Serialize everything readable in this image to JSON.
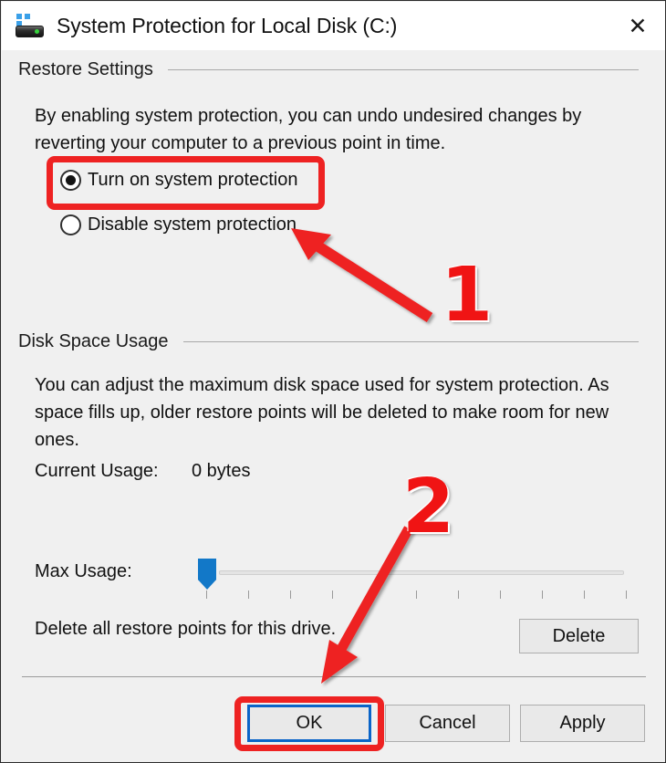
{
  "window": {
    "title": "System Protection for Local Disk (C:)",
    "icon": "system-protection-disk-icon",
    "close_label": "✕"
  },
  "restore_settings": {
    "group_title": "Restore Settings",
    "description": "By enabling system protection, you can undo undesired changes by reverting your computer to a previous point in time.",
    "options": [
      {
        "label": "Turn on system protection",
        "selected": true
      },
      {
        "label": "Disable system protection",
        "selected": false
      }
    ]
  },
  "disk_space_usage": {
    "group_title": "Disk Space Usage",
    "description": "You can adjust the maximum disk space used for system protection. As space fills up, older restore points will be deleted to make room for new ones.",
    "current_usage_label": "Current Usage:",
    "current_usage_value": "0 bytes",
    "max_usage_label": "Max Usage:",
    "max_usage_percent": 0
  },
  "delete_section": {
    "text": "Delete all restore points for this drive.",
    "button_label": "Delete"
  },
  "footer": {
    "ok_label": "OK",
    "cancel_label": "Cancel",
    "apply_label": "Apply"
  },
  "annotations": {
    "accent_color": "#ee2222",
    "step_one": "1",
    "step_two": "2"
  }
}
